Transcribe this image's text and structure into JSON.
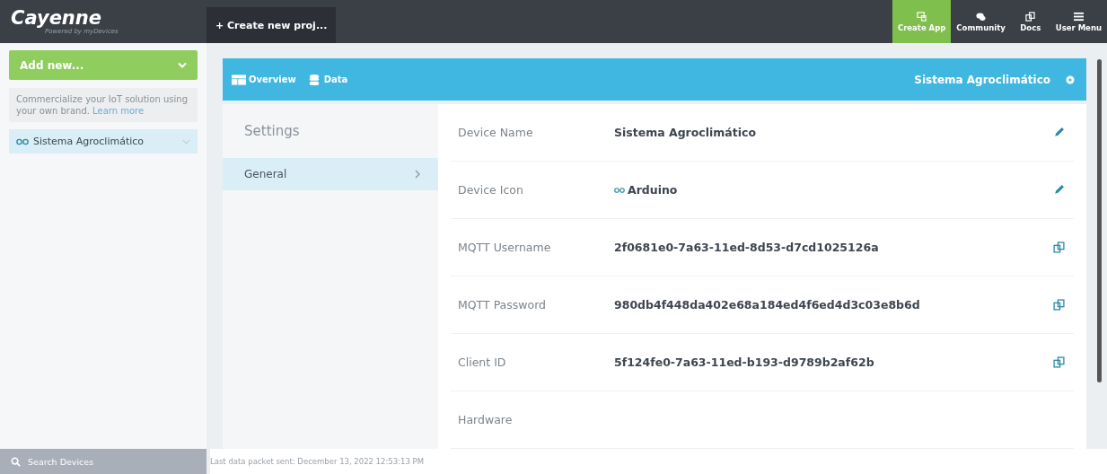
{
  "header": {
    "logo": "Cayenne",
    "tagline": "Powered by myDevices",
    "create_project": "+ Create new proj...",
    "nav": [
      {
        "label": "Create App",
        "kind": "app",
        "selected": true
      },
      {
        "label": "Community",
        "kind": "chat",
        "selected": false
      },
      {
        "label": "Docs",
        "kind": "docs",
        "selected": false
      },
      {
        "label": "User Menu",
        "kind": "menu",
        "selected": false
      }
    ]
  },
  "sidebar": {
    "add_new": "Add new...",
    "promo": "Commercialize your IoT solution using your own brand.",
    "promo_link": "Learn more",
    "devices": [
      {
        "name": "Sistema Agroclimático",
        "selected": true
      }
    ],
    "search": "Search Devices"
  },
  "device_bar": {
    "tabs": [
      {
        "label": "Overview",
        "kind": "overview"
      },
      {
        "label": "Data",
        "kind": "data"
      }
    ],
    "device_name": "Sistema Agroclimático"
  },
  "settings": {
    "title": "Settings",
    "items": [
      {
        "label": "General",
        "selected": true
      }
    ]
  },
  "fields": [
    {
      "label": "Device Name",
      "value": "Sistema Agroclimático",
      "kind": "editable"
    },
    {
      "label": "Device Icon",
      "value": "Arduino",
      "kind": "editable_icon"
    },
    {
      "label": "MQTT Username",
      "value": "2f0681e0-7a63-11ed-8d53-d7cd1025126a",
      "kind": "copyable"
    },
    {
      "label": "MQTT Password",
      "value": "980db4f448da402e68a184ed4f6ed4d3c03e8b6d",
      "kind": "copyable"
    },
    {
      "label": "Client ID",
      "value": "5f124fe0-7a63-11ed-b193-d9789b2af62b",
      "kind": "copyable"
    },
    {
      "label": "Hardware",
      "kind": "plain"
    }
  ],
  "status_bar": "Last data packet sent: December 13, 2022 12:53:13 PM"
}
